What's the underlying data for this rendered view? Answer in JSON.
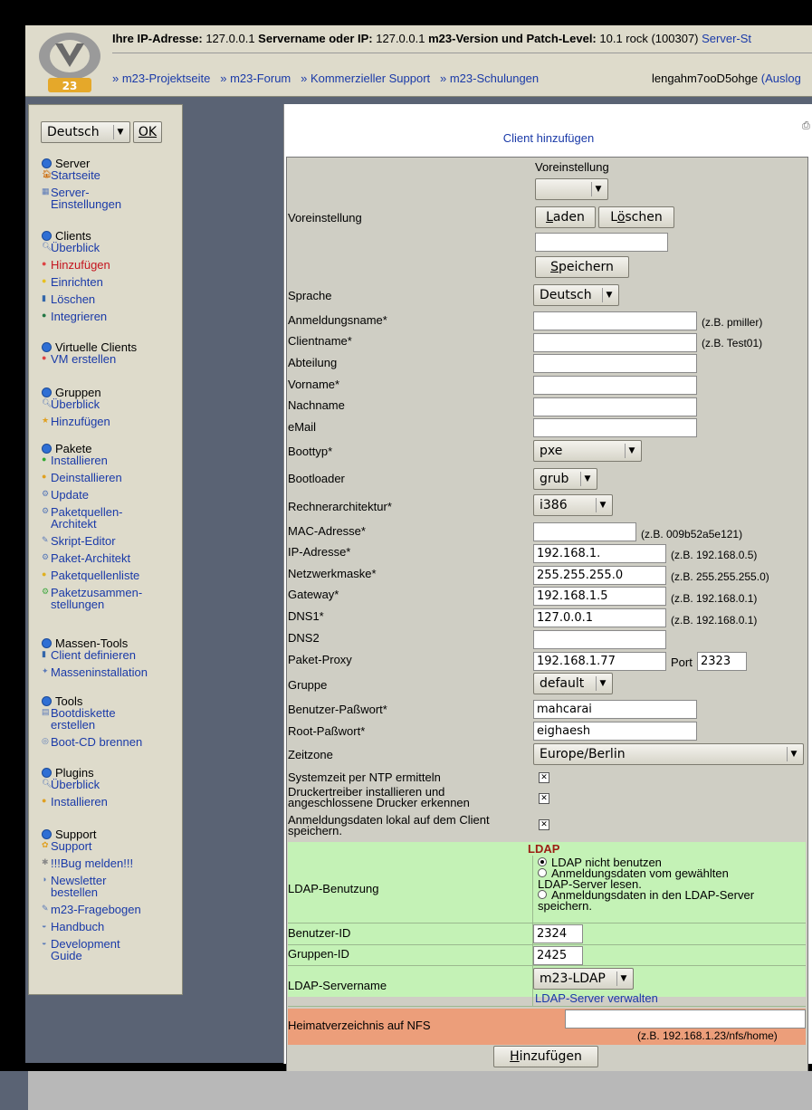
{
  "header": {
    "ip_label": "Ihre IP-Adresse:",
    "ip_value": "127.0.0.1",
    "server_label": "Servername oder IP:",
    "server_value": "127.0.0.1",
    "version_label": "m23-Version und Patch-Level:",
    "version_value": "10.1 rock (100307)",
    "status_link": "Server-St",
    "nav": [
      "» m23-Projektseite",
      "» m23-Forum",
      "» Kommerzieller Support",
      "» m23-Schulungen"
    ],
    "user": "lengahm7ooD5ohge",
    "logout": "(Auslog"
  },
  "sidebar": {
    "language": "Deutsch",
    "ok": "OK",
    "sections": [
      {
        "title": "Server",
        "items": [
          {
            "label": "Startseite",
            "icon": "home-icon"
          },
          {
            "label": "Server-\nEinstellungen",
            "icon": "settings-icon"
          }
        ]
      },
      {
        "title": "Clients",
        "items": [
          {
            "label": "Überblick",
            "icon": "magnifier-icon"
          },
          {
            "label": "Hinzufügen",
            "icon": "add-icon",
            "active": true
          },
          {
            "label": "Einrichten",
            "icon": "setup-icon"
          },
          {
            "label": "Löschen",
            "icon": "trash-icon"
          },
          {
            "label": "Integrieren",
            "icon": "integrate-icon"
          }
        ]
      },
      {
        "title": "Virtuelle Clients",
        "items": [
          {
            "label": "VM erstellen",
            "icon": "vm-icon"
          }
        ]
      },
      {
        "title": "Gruppen",
        "items": [
          {
            "label": "Überblick",
            "icon": "magnifier-icon"
          },
          {
            "label": "Hinzufügen",
            "icon": "star-icon"
          }
        ]
      },
      {
        "title": "Pakete",
        "items": [
          {
            "label": "Installieren",
            "icon": "install-icon"
          },
          {
            "label": "Deinstallieren",
            "icon": "uninstall-icon"
          },
          {
            "label": "Update",
            "icon": "update-icon"
          },
          {
            "label": "Paketquellen-\nArchitekt",
            "icon": "architect-icon"
          },
          {
            "label": "Skript-Editor",
            "icon": "script-icon"
          },
          {
            "label": "Paket-Architekt",
            "icon": "package-icon"
          },
          {
            "label": "Paketquellenliste",
            "icon": "list-icon"
          },
          {
            "label": "Paketzusammen-\nstellungen",
            "icon": "bundle-icon"
          }
        ]
      },
      {
        "title": "Massen-Tools",
        "items": [
          {
            "label": "Client definieren",
            "icon": "define-icon"
          },
          {
            "label": "Masseninstallation",
            "icon": "mass-icon"
          }
        ]
      },
      {
        "title": "Tools",
        "items": [
          {
            "label": "Bootdiskette\nerstellen",
            "icon": "floppy-icon"
          },
          {
            "label": "Boot-CD brennen",
            "icon": "cd-icon"
          }
        ]
      },
      {
        "title": "Plugins",
        "items": [
          {
            "label": "Überblick",
            "icon": "magnifier-icon"
          },
          {
            "label": "Installieren",
            "icon": "plugin-icon"
          }
        ]
      },
      {
        "title": "Support",
        "items": [
          {
            "label": "Support",
            "icon": "support-icon"
          },
          {
            "label": "!!!Bug melden!!!",
            "icon": "bug-icon"
          },
          {
            "label": "Newsletter\nbestellen",
            "icon": "newsletter-icon"
          },
          {
            "label": "m23-Fragebogen",
            "icon": "form-icon"
          },
          {
            "label": "Handbuch",
            "icon": "book-icon"
          },
          {
            "label": "Development\nGuide",
            "icon": "book-icon"
          }
        ]
      }
    ]
  },
  "main": {
    "title": "Client hinzufügen",
    "preset": {
      "label": "Voreinstellung",
      "heading": "Voreinstellung",
      "select_value": "",
      "load": "Laden",
      "delete": "Löschen",
      "name_value": "",
      "save": "Speichern"
    },
    "fields": {
      "language": {
        "label": "Sprache",
        "value": "Deutsch"
      },
      "login": {
        "label": "Anmeldungsname*",
        "value": "",
        "hint": "(z.B. pmiller)"
      },
      "clientname": {
        "label": "Clientname*",
        "value": "",
        "hint": "(z.B. Test01)"
      },
      "department": {
        "label": "Abteilung",
        "value": ""
      },
      "firstname": {
        "label": "Vorname*",
        "value": ""
      },
      "lastname": {
        "label": "Nachname",
        "value": ""
      },
      "email": {
        "label": "eMail",
        "value": ""
      },
      "boottype": {
        "label": "Boottyp*",
        "value": "pxe"
      },
      "bootloader": {
        "label": "Bootloader",
        "value": "grub"
      },
      "arch": {
        "label": "Rechnerarchitektur*",
        "value": "i386"
      },
      "mac": {
        "label": "MAC-Adresse*",
        "value": "",
        "hint": "(z.B. 009b52a5e121)"
      },
      "ip": {
        "label": "IP-Adresse*",
        "value": "192.168.1.",
        "hint": "(z.B. 192.168.0.5)"
      },
      "netmask": {
        "label": "Netzwerkmaske*",
        "value": "255.255.255.0",
        "hint": "(z.B. 255.255.255.0)"
      },
      "gateway": {
        "label": "Gateway*",
        "value": "192.168.1.5",
        "hint": "(z.B. 192.168.0.1)"
      },
      "dns1": {
        "label": "DNS1*",
        "value": "127.0.0.1",
        "hint": "(z.B. 192.168.0.1)"
      },
      "dns2": {
        "label": "DNS2",
        "value": ""
      },
      "proxy": {
        "label": "Paket-Proxy",
        "value": "192.168.1.77",
        "port_label": "Port",
        "port_value": "2323"
      },
      "group": {
        "label": "Gruppe",
        "value": "default"
      },
      "user_pw": {
        "label": "Benutzer-Paßwort*",
        "value": "mahcarai"
      },
      "root_pw": {
        "label": "Root-Paßwort*",
        "value": "eighaesh"
      },
      "timezone": {
        "label": "Zeitzone",
        "value": "Europe/Berlin"
      },
      "ntp": {
        "label": "Systemzeit per NTP ermitteln",
        "checked": true
      },
      "printer": {
        "label": "Druckertreiber installieren und\nangeschlossene Drucker erkennen",
        "checked": true
      },
      "localauth": {
        "label": "Anmeldungsdaten lokal auf dem Client\nspeichern.",
        "checked": true
      }
    },
    "ldap": {
      "heading": "LDAP",
      "usage_label": "LDAP-Benutzung",
      "options": [
        "LDAP nicht benutzen",
        "Anmeldungsdaten vom gewählten\nLDAP-Server lesen.",
        "Anmeldungsdaten in den LDAP-Server\nspeichern."
      ],
      "selected": 0,
      "userid_label": "Benutzer-ID",
      "userid_value": "2324",
      "groupid_label": "Gruppen-ID",
      "groupid_value": "2425",
      "server_label": "LDAP-Servername",
      "server_value": "m23-LDAP",
      "manage_link": "LDAP-Server verwalten"
    },
    "nfs": {
      "label": "Heimatverzeichnis auf NFS",
      "value": "",
      "hint": "(z.B. 192.168.1.23/nfs/home)"
    },
    "submit": "Hinzufügen"
  }
}
